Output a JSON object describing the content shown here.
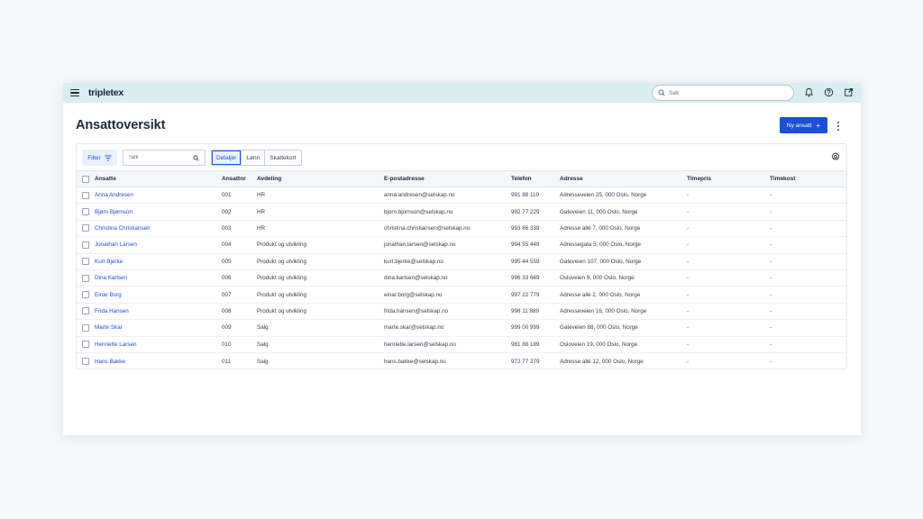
{
  "app": {
    "logo": "tripletex",
    "search_placeholder": "Søk"
  },
  "page": {
    "title": "Ansattoversikt",
    "new_button_label": "Ny ansatt",
    "new_button_icon": "+"
  },
  "toolbar": {
    "filter_label": "Filter",
    "search_placeholder": "Søk",
    "view_tabs": [
      "Detaljer",
      "Lønn",
      "Skattekort"
    ],
    "active_tab": "Detaljer"
  },
  "table": {
    "columns": [
      "Ansatte",
      "Ansattnr",
      "Avdeling",
      "E-postadresse",
      "Telefon",
      "Adresse",
      "Timepris",
      "Timekost"
    ],
    "rows": [
      {
        "name": "Anna Andresen",
        "nr": "001",
        "dept": "HR",
        "email": "anna.andresen@selskap.no",
        "phone": "991 88 119",
        "address": "Adresseveien 25, 000 Oslo, Norge",
        "rate": "-",
        "cost": "-"
      },
      {
        "name": "Bjørn Bjørnson",
        "nr": "002",
        "dept": "HR",
        "email": "bjorn.bjornson@selskap.no",
        "phone": "992 77 229",
        "address": "Gateveien 11, 000 Oslo, Norge",
        "rate": "-",
        "cost": "-"
      },
      {
        "name": "Christina Christiansen",
        "nr": "003",
        "dept": "HR",
        "email": "christina.christiansen@selskap.no",
        "phone": "993 66 339",
        "address": "Adresse allé 7, 000 Oslo, Norge",
        "rate": "-",
        "cost": "-"
      },
      {
        "name": "Jonathan Larsen",
        "nr": "004",
        "dept": "Produkt og utvikling",
        "email": "jonathan.larsen@selskap.no",
        "phone": "994 55 449",
        "address": "Adressegata 5, 000 Oslo, Norge",
        "rate": "-",
        "cost": "-"
      },
      {
        "name": "Kurt Bjerke",
        "nr": "005",
        "dept": "Produkt og utvikling",
        "email": "kurt.bjerke@selskap.no",
        "phone": "995 44 559",
        "address": "Gateveien 107, 000 Oslo, Norge",
        "rate": "-",
        "cost": "-"
      },
      {
        "name": "Dina Karlsen",
        "nr": "006",
        "dept": "Produkt og utvikling",
        "email": "dina.karlsen@selskap.no",
        "phone": "996 33 669",
        "address": "Osloveien 9, 000 Oslo, Norge",
        "rate": "-",
        "cost": "-"
      },
      {
        "name": "Einar Borg",
        "nr": "007",
        "dept": "Produkt og utvikling",
        "email": "einar.borg@selskap.no",
        "phone": "997 22 779",
        "address": "Adresse allé 2, 000 Oslo, Norge",
        "rate": "-",
        "cost": "-"
      },
      {
        "name": "Frida Hansen",
        "nr": "008",
        "dept": "Produkt og utvikling",
        "email": "frida.hansen@selskap.no",
        "phone": "998 11 889",
        "address": "Adresseveien 16, 000 Oslo, Norge",
        "rate": "-",
        "cost": "-"
      },
      {
        "name": "Marte Skar",
        "nr": "009",
        "dept": "Salg",
        "email": "marte.skar@selskap.no",
        "phone": "999 00 999",
        "address": "Gateveien 88, 000 Oslo, Norge",
        "rate": "-",
        "cost": "-"
      },
      {
        "name": "Henriette Larsen",
        "nr": "010",
        "dept": "Salg",
        "email": "henriette.larsen@selskap.no",
        "phone": "981 88 189",
        "address": "Osloveien 19, 000 Oslo, Norge",
        "rate": "-",
        "cost": "-"
      },
      {
        "name": "Hans Bakke",
        "nr": "011",
        "dept": "Salg",
        "email": "hans.bakke@selskap.no",
        "phone": "972 77 279",
        "address": "Adresse allé 12, 000 Oslo, Norge",
        "rate": "-",
        "cost": "-"
      }
    ]
  },
  "colors": {
    "topbar_bg": "#d8eef1",
    "accent": "#1d4ed8"
  },
  "icons": [
    "menu-icon",
    "search-icon",
    "bell-icon",
    "help-icon",
    "external-link-icon",
    "plus-icon",
    "kebab-icon",
    "filter-icon",
    "gear-icon"
  ]
}
